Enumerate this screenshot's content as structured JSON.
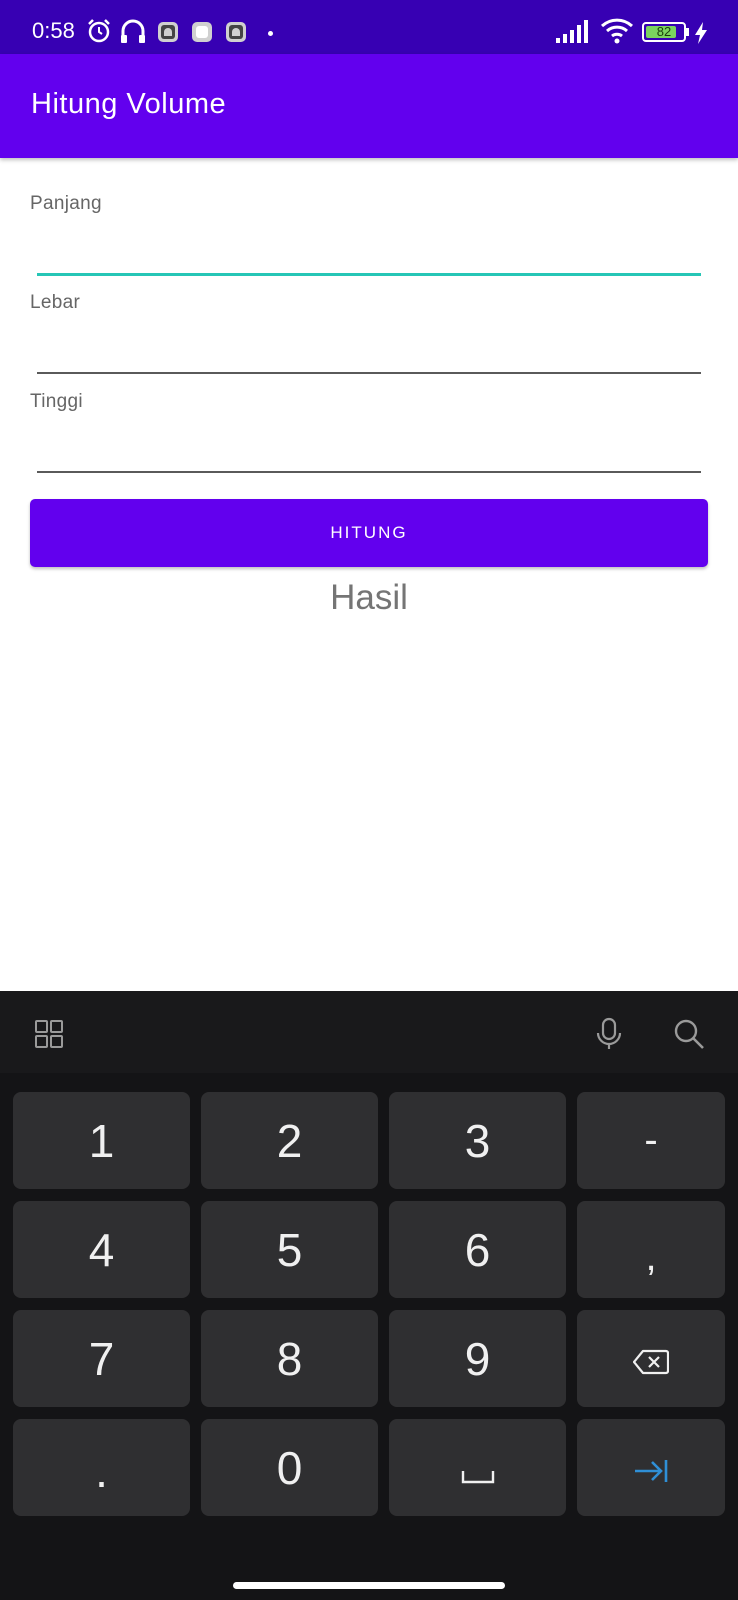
{
  "status_bar": {
    "time": "0:58",
    "battery": "82",
    "battery_level": 0.82
  },
  "app_bar": {
    "title": "Hitung Volume"
  },
  "form": {
    "fields": [
      {
        "label": "Panjang",
        "value": ""
      },
      {
        "label": "Lebar",
        "value": ""
      },
      {
        "label": "Tinggi",
        "value": ""
      }
    ],
    "button_label": "HITUNG",
    "result": "Hasil"
  },
  "keyboard": {
    "rows": [
      [
        "1",
        "2",
        "3",
        "-"
      ],
      [
        "4",
        "5",
        "6",
        ","
      ],
      [
        "7",
        "8",
        "9",
        "backspace-icon"
      ],
      [
        ".",
        "0",
        "space-icon",
        "next-field-icon"
      ]
    ],
    "toolbar_icons": [
      "grid-icon",
      "mic-icon",
      "search-icon"
    ]
  },
  "colors": {
    "status_bar": "#3700b3",
    "primary": "#6200ee",
    "focus_underline": "#26c6b6",
    "keyboard_bg": "#141416",
    "key_bg": "#2f2f31",
    "accent_key_icon": "#2f8fd6"
  }
}
